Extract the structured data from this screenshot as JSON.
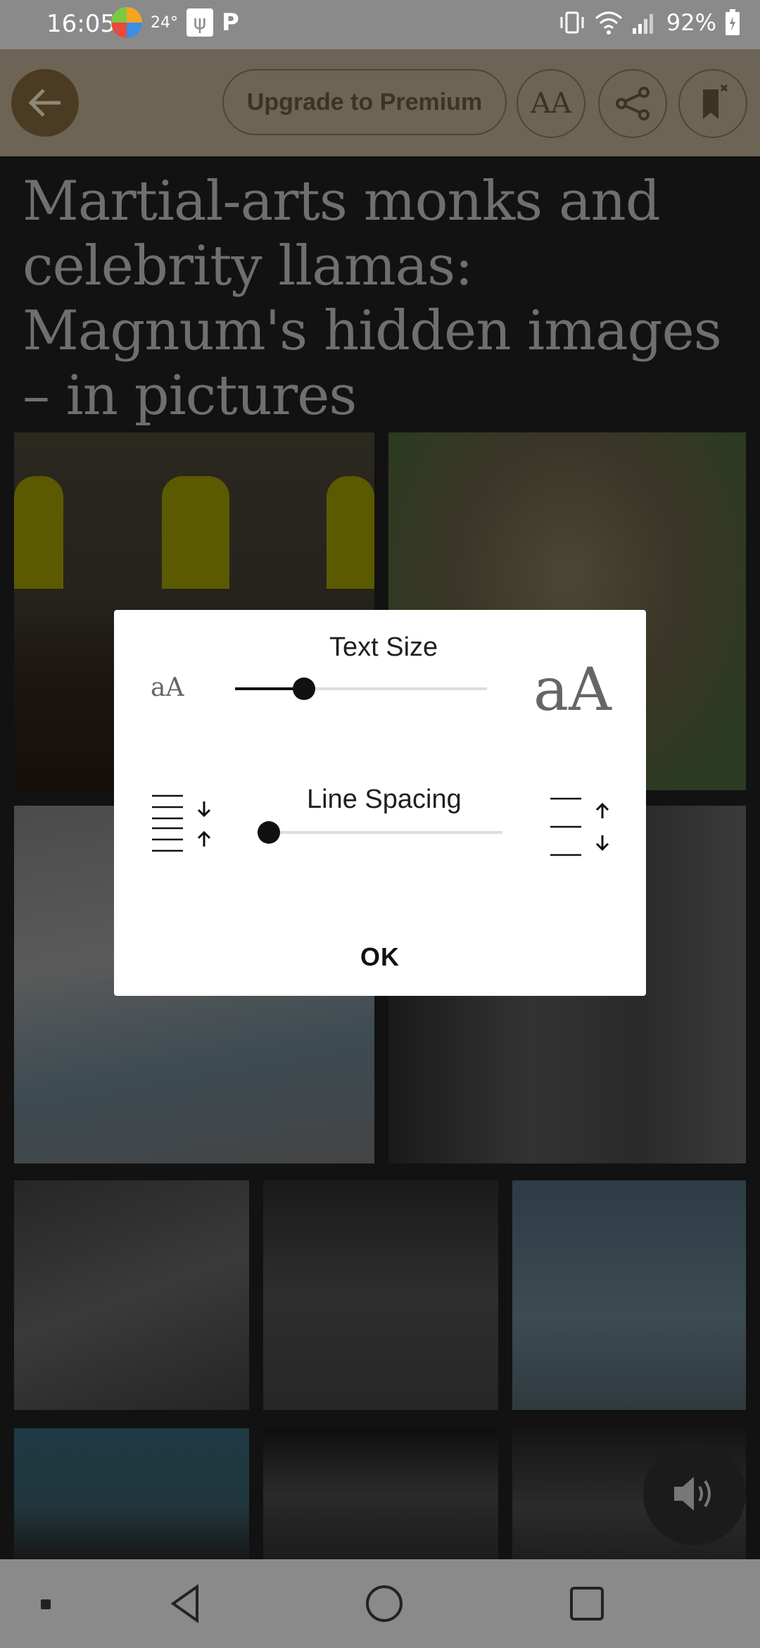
{
  "status_bar": {
    "time": "16:05",
    "temperature": "24°",
    "battery": "92%"
  },
  "toolbar": {
    "upgrade_label": "Upgrade to Premium",
    "text_size_icon_label": "AA"
  },
  "article": {
    "headline": "Martial-arts monks and celebrity llamas: Magnum's hidden images – in pictures"
  },
  "dialog": {
    "text_size_label": "Text Size",
    "text_size_small_sample": "aA",
    "text_size_large_sample": "aA",
    "text_size_level": 0.25,
    "line_spacing_label": "Line Spacing",
    "line_spacing_level": 0.0,
    "ok_label": "OK"
  },
  "colors": {
    "toolbar_dim": "#6e6455",
    "back_button": "#4b3b22",
    "dialog_bg": "#ffffff"
  }
}
